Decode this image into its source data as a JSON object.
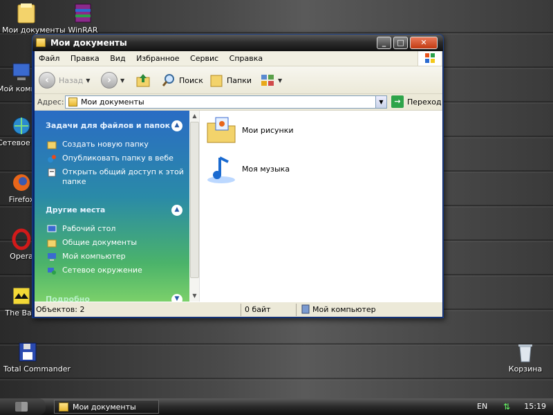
{
  "desktop": {
    "icons": [
      {
        "label": "Мои документы",
        "name": "desktop-icon-my-documents"
      },
      {
        "label": "WinRAR",
        "name": "desktop-icon-winrar"
      },
      {
        "label": "Мой компьютер",
        "name": "desktop-icon-my-computer"
      },
      {
        "label": "Сетевое окружение",
        "name": "desktop-icon-network"
      },
      {
        "label": "Firefox",
        "name": "desktop-icon-firefox"
      },
      {
        "label": "Opera",
        "name": "desktop-icon-opera"
      },
      {
        "label": "The Bat!",
        "name": "desktop-icon-the-bat"
      },
      {
        "label": "Total Commander",
        "name": "desktop-icon-total-commander"
      },
      {
        "label": "Корзина",
        "name": "desktop-icon-recycle-bin"
      }
    ]
  },
  "window": {
    "title": "Мои документы",
    "menu": [
      "Файл",
      "Правка",
      "Вид",
      "Избранное",
      "Сервис",
      "Справка"
    ],
    "toolbar": {
      "back": "Назад",
      "search": "Поиск",
      "folders": "Папки"
    },
    "address": {
      "label": "Адрес:",
      "value": "Мои документы",
      "go": "Переход"
    },
    "tasks_panel": {
      "title": "Задачи для файлов и папок",
      "items": [
        "Создать новую папку",
        "Опубликовать папку в вебе",
        "Открыть общий доступ к этой папке"
      ]
    },
    "places_panel": {
      "title": "Другие места",
      "items": [
        "Рабочий стол",
        "Общие документы",
        "Мой компьютер",
        "Сетевое окружение"
      ]
    },
    "details_panel": {
      "title": "Подробно"
    },
    "files": [
      {
        "label": "Мои рисунки",
        "icon": "my-pictures-folder-icon"
      },
      {
        "label": "Моя музыка",
        "icon": "my-music-folder-icon"
      }
    ],
    "status": {
      "objects": "Объектов: 2",
      "size": "0 байт",
      "location": "Мой компьютер"
    }
  },
  "taskbar": {
    "task_label": "Мои документы",
    "lang": "EN",
    "clock": "15:19"
  }
}
